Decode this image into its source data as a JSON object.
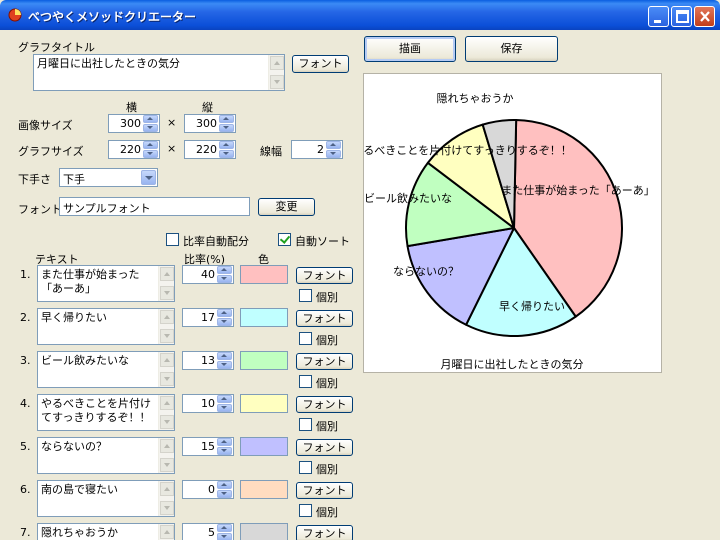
{
  "window": {
    "title": "べつやくメソッドクリエーター"
  },
  "graph_title": {
    "label": "グラフタイトル",
    "value": "月曜日に出社したときの気分",
    "font_button": "フォント"
  },
  "image_size": {
    "label": "画像サイズ",
    "width_header": "横",
    "height_header": "縦",
    "width": "300",
    "height": "300",
    "times": "×"
  },
  "graph_size": {
    "label": "グラフサイズ",
    "width": "220",
    "height": "220",
    "times": "×",
    "line_width_label": "線幅",
    "line_width": "2"
  },
  "clumsiness": {
    "label": "下手さ",
    "selected": "下手"
  },
  "font": {
    "label": "フォント",
    "value": "サンプルフォント",
    "change_button": "変更"
  },
  "options": {
    "auto_ratio_label": "比率自動配分",
    "auto_ratio_checked": false,
    "auto_sort_label": "自動ソート",
    "auto_sort_checked": true
  },
  "list_headers": {
    "text": "テキスト",
    "ratio": "比率(%)",
    "color": "色"
  },
  "item_font_button": "フォント",
  "item_individual_label": "個別",
  "items": [
    {
      "num": "1.",
      "text": "また仕事が始まった「あーあ」",
      "ratio": "40",
      "color": "#ffc0c0"
    },
    {
      "num": "2.",
      "text": "早く帰りたい",
      "ratio": "17",
      "color": "#c0ffff"
    },
    {
      "num": "3.",
      "text": "ビール飲みたいな",
      "ratio": "13",
      "color": "#c0ffc0"
    },
    {
      "num": "4.",
      "text": "やるべきことを片付けてすっきりするぞ！！",
      "ratio": "10",
      "color": "#ffffc0"
    },
    {
      "num": "5.",
      "text": "ならないの？",
      "ratio": "15",
      "color": "#c0c0ff"
    },
    {
      "num": "6.",
      "text": "南の島で寝たい",
      "ratio": "0",
      "color": "#ffdcc0"
    },
    {
      "num": "7.",
      "text": "隠れちゃおうか",
      "ratio": "5",
      "color": "#d8d8d8"
    }
  ],
  "toolbar": {
    "draw_button": "描画",
    "save_button": "保存"
  },
  "preview": {
    "caption": "月曜日に出社したときの気分",
    "slice_labels": [
      "また仕事が始まった「あーあ」",
      "早く帰りたい",
      "ならないの？",
      "ビール飲みたいな",
      "やるべきことを片付けてすっきりするぞ！！",
      "隠れちゃおうか"
    ]
  },
  "chart_data": {
    "type": "pie",
    "title": "月曜日に出社したときの気分",
    "categories": [
      "また仕事が始まった「あーあ」",
      "早く帰りたい",
      "ならないの？",
      "ビール飲みたいな",
      "やるべきことを片付けてすっきりするぞ！！",
      "隠れちゃおうか"
    ],
    "values": [
      40,
      17,
      15,
      13,
      10,
      5
    ],
    "colors": [
      "#ffc0c0",
      "#c0ffff",
      "#c0c0ff",
      "#c0ffc0",
      "#ffffc0",
      "#d8d8d8"
    ]
  }
}
